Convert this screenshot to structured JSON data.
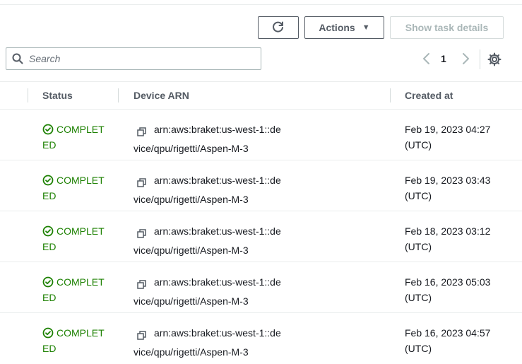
{
  "toolbar": {
    "actions_label": "Actions",
    "show_details_label": "Show task details"
  },
  "search": {
    "placeholder": "Search"
  },
  "pagination": {
    "current_page": "1"
  },
  "table": {
    "headers": {
      "status": "Status",
      "device_arn": "Device ARN",
      "created_at": "Created at"
    },
    "rows": [
      {
        "status": "COMPLETED",
        "device_arn": "arn:aws:braket:us-west-1::device/qpu/rigetti/Aspen-M-3",
        "created_at": "Feb 19, 2023 04:27 (UTC)"
      },
      {
        "status": "COMPLETED",
        "device_arn": "arn:aws:braket:us-west-1::device/qpu/rigetti/Aspen-M-3",
        "created_at": "Feb 19, 2023 03:43 (UTC)"
      },
      {
        "status": "COMPLETED",
        "device_arn": "arn:aws:braket:us-west-1::device/qpu/rigetti/Aspen-M-3",
        "created_at": "Feb 18, 2023 03:12 (UTC)"
      },
      {
        "status": "COMPLETED",
        "device_arn": "arn:aws:braket:us-west-1::device/qpu/rigetti/Aspen-M-3",
        "created_at": "Feb 16, 2023 05:03 (UTC)"
      },
      {
        "status": "COMPLETED",
        "device_arn": "arn:aws:braket:us-west-1::device/qpu/rigetti/Aspen-M-3",
        "created_at": "Feb 16, 2023 04:57 (UTC)"
      }
    ]
  },
  "icons": {
    "refresh": "refresh-icon",
    "caret": "caret-down-icon",
    "search": "search-icon",
    "prev": "chevron-left-icon",
    "next": "chevron-right-icon",
    "settings": "gear-icon",
    "status": "check-circle-icon",
    "copy": "copy-icon"
  },
  "colors": {
    "success": "#1d8102",
    "border": "#545b64",
    "disabled": "#aab7b8",
    "divider": "#eaeded"
  }
}
